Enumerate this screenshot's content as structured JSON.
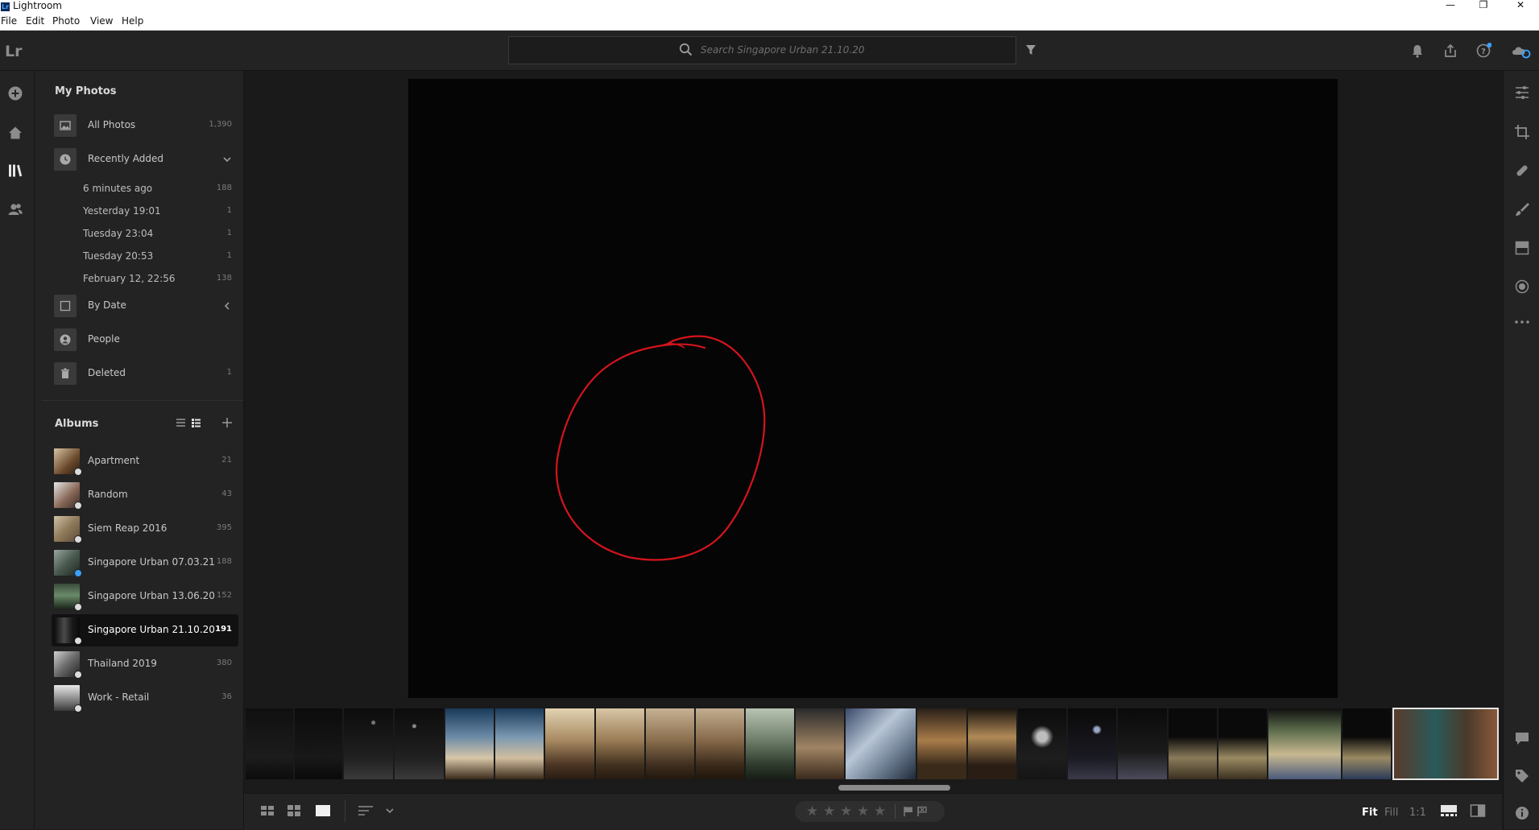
{
  "window": {
    "title": "Lightroom",
    "app_icon": "Lr",
    "controls": [
      "—",
      "❐",
      "✕"
    ]
  },
  "menu": [
    "File",
    "Edit",
    "Photo",
    "View",
    "Help"
  ],
  "appbar": {
    "logo": "Lr",
    "search_placeholder": "Search Singapore Urban 21.10.20"
  },
  "sidebar": {
    "my_photos_heading": "My Photos",
    "all_photos": {
      "label": "All Photos",
      "count": "1,390"
    },
    "recently_added": {
      "label": "Recently Added"
    },
    "recent_items": [
      {
        "label": "6 minutes ago",
        "count": "188"
      },
      {
        "label": "Yesterday 19:01",
        "count": "1"
      },
      {
        "label": "Tuesday  23:04",
        "count": "1"
      },
      {
        "label": "Tuesday  20:53",
        "count": "1"
      },
      {
        "label": "February 12, 22:56",
        "count": "138"
      }
    ],
    "by_date": {
      "label": "By Date"
    },
    "people": {
      "label": "People"
    },
    "deleted": {
      "label": "Deleted",
      "count": "1"
    },
    "albums_heading": "Albums",
    "albums": [
      {
        "label": "Apartment",
        "count": "21"
      },
      {
        "label": "Random",
        "count": "43"
      },
      {
        "label": "Siem Reap 2016",
        "count": "395"
      },
      {
        "label": "Singapore Urban 07.03.21",
        "count": "188"
      },
      {
        "label": "Singapore Urban 13.06.20",
        "count": "152"
      },
      {
        "label": "Singapore Urban 21.10.20",
        "count": "191",
        "selected": true
      },
      {
        "label": "Thailand 2019",
        "count": "380"
      },
      {
        "label": "Work - Retail",
        "count": "36"
      }
    ]
  },
  "bottombar": {
    "zoom_fit": "Fit",
    "zoom_fill": "Fill",
    "zoom_1to1": "1:1",
    "rating_stars": "★"
  },
  "colors": {
    "accent": "#3aa0ff",
    "annotation": "#d4141c",
    "panel": "#232323",
    "background": "#1a1a1a"
  }
}
